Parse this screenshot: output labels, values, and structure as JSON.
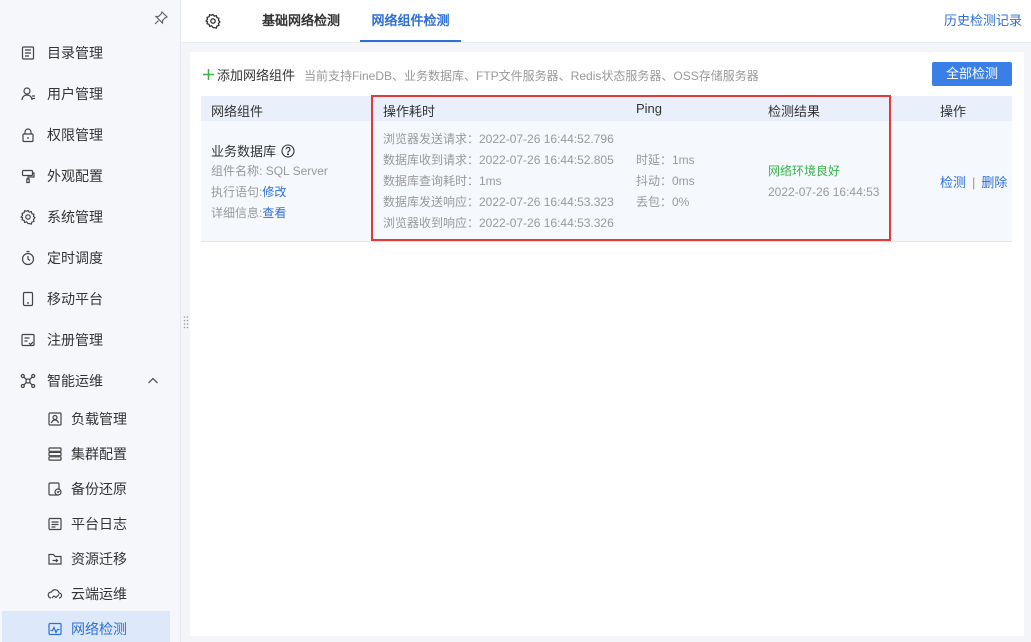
{
  "sidebar": {
    "menu": [
      {
        "label": "目录管理",
        "icon": "catalog-icon"
      },
      {
        "label": "用户管理",
        "icon": "user-icon"
      },
      {
        "label": "权限管理",
        "icon": "lock-icon"
      },
      {
        "label": "外观配置",
        "icon": "appearance-icon"
      },
      {
        "label": "系统管理",
        "icon": "gear-icon"
      },
      {
        "label": "定时调度",
        "icon": "timer-icon"
      },
      {
        "label": "移动平台",
        "icon": "mobile-icon"
      },
      {
        "label": "注册管理",
        "icon": "register-icon"
      },
      {
        "label": "智能运维",
        "icon": "ops-icon"
      }
    ],
    "submenu": [
      {
        "label": "负载管理",
        "icon": "load-icon"
      },
      {
        "label": "集群配置",
        "icon": "cluster-icon"
      },
      {
        "label": "备份还原",
        "icon": "backup-icon"
      },
      {
        "label": "平台日志",
        "icon": "log-icon"
      },
      {
        "label": "资源迁移",
        "icon": "migrate-icon"
      },
      {
        "label": "云端运维",
        "icon": "cloud-ops-icon"
      },
      {
        "label": "网络检测",
        "icon": "network-check-icon",
        "active": true
      }
    ]
  },
  "topbar": {
    "tabs": [
      {
        "label": "基础网络检测"
      },
      {
        "label": "网络组件检测",
        "active": true
      }
    ],
    "history_link": "历史检测记录"
  },
  "toolbar": {
    "add_label": "添加网络组件",
    "hint": "当前支持FineDB、业务数据库、FTP文件服务器、Redis状态服务器、OSS存储服务器",
    "detect_all_label": "全部检测"
  },
  "table": {
    "columns": [
      "网络组件",
      "操作耗时",
      "Ping",
      "检测结果",
      "操作"
    ],
    "row": {
      "component_title": "业务数据库",
      "name_label": "组件名称:",
      "name_value": "SQL Server",
      "stmt_label": "执行语句:",
      "stmt_link": "修改",
      "detail_label": "详细信息:",
      "detail_link": "查看",
      "timings": [
        "浏览器发送请求：2022-07-26 16:44:52.796",
        "数据库收到请求：2022-07-26 16:44:52.805",
        "数据库查询耗时：1ms",
        "数据库发送响应：2022-07-26 16:44:53.323",
        "浏览器收到响应：2022-07-26 16:44:53.326"
      ],
      "ping": [
        "时延：1ms",
        "抖动：0ms",
        "丢包：0%"
      ],
      "result_status": "网络环境良好",
      "result_time": "2022-07-26 16:44:53",
      "op_detect": "检测",
      "op_sep": "|",
      "op_delete": "删除"
    }
  },
  "colors": {
    "accent": "#2f6fd6",
    "primary_button": "#3a7fe6",
    "success": "#3ab34a",
    "highlight_border": "#e03a3a"
  }
}
